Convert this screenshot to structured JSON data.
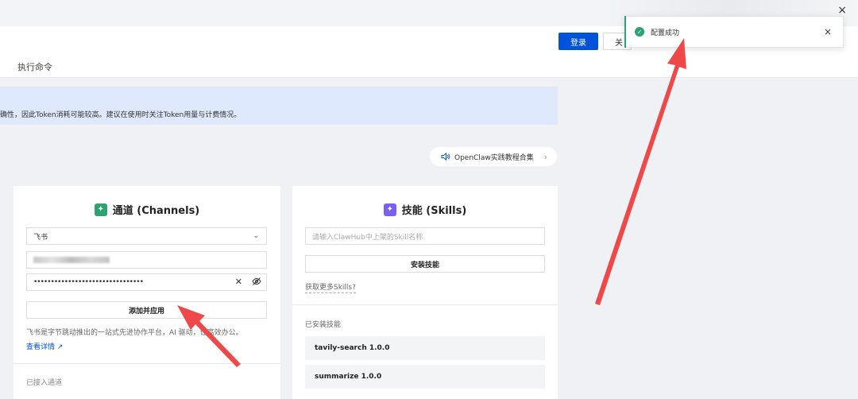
{
  "window": {
    "close_glyph": "×"
  },
  "header": {
    "tab_exec": "执行命令",
    "login_label": "登录",
    "close_label": "关"
  },
  "notice": {
    "text": "确性，因此Token消耗可能较高。建议在使用时关注Token用量与计费情况。"
  },
  "tutorial": {
    "label": "OpenClaw实践教程合集",
    "icon": "speaker-icon"
  },
  "channels": {
    "title": "通道 (Channels)",
    "select_value": "飞书",
    "password_mask": "••••••••••••••••••••••••••••••••",
    "add_button": "添加并应用",
    "description": "飞书是字节跳动推出的一站式先进协作平台，AI 驱动，让高效办公。",
    "details_link": "查看详情",
    "connected_label": "已接入通道"
  },
  "skills": {
    "title": "技能 (Skills)",
    "input_placeholder": "请输入ClawHub中上架的Skill名称",
    "install_button": "安装技能",
    "get_more": "获取更多Skills?",
    "installed_label": "已安装技能",
    "installed": [
      {
        "name": "tavily-search 1.0.0"
      },
      {
        "name": "summarize 1.0.0"
      }
    ]
  },
  "toast": {
    "message": "配置成功",
    "close_glyph": "×"
  },
  "colors": {
    "primary": "#0052d9",
    "success": "#2ba471",
    "annotation_arrow": "#ef4848"
  }
}
